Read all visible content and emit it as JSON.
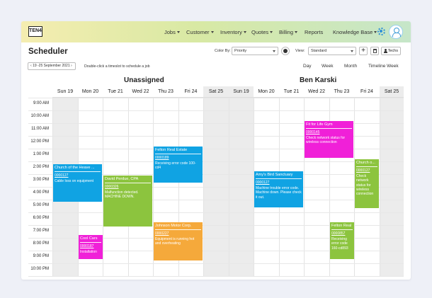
{
  "app": {
    "logo": "TEN4",
    "title": "Scheduler"
  },
  "nav": [
    {
      "label": "Jobs",
      "dropdown": true
    },
    {
      "label": "Customer",
      "dropdown": true
    },
    {
      "label": "Inventory",
      "dropdown": true
    },
    {
      "label": "Quotes",
      "dropdown": true
    },
    {
      "label": "Billing",
      "dropdown": true
    },
    {
      "label": "Reports",
      "dropdown": false
    },
    {
      "label": "Knowledge Base",
      "dropdown": true
    }
  ],
  "toolbar": {
    "color_by_label": "Color By:",
    "color_by_value": "Priority",
    "view_label": "View:",
    "view_value": "Standard",
    "add_label": "+",
    "techs_label": "Techs"
  },
  "date_range": "19 -25 September 2021",
  "hint": "Double-click a timeslot to schedule a job",
  "views": [
    "Day",
    "Week",
    "Month",
    "Timeline Week"
  ],
  "resources": [
    "Unassigned",
    "Ben Karski"
  ],
  "days": [
    "Sun 19",
    "Mon 20",
    "Tue 21",
    "Wed 22",
    "Thu 23",
    "Fri 24",
    "Sat 25",
    "Sun 19",
    "Mon 20",
    "Tue 21",
    "Wed 22",
    "Thu 23",
    "Fri 24",
    "Sat 25"
  ],
  "times": [
    "9:00 AM",
    "10:00 AM",
    "11:00 AM",
    "12:00 PM",
    "1:00 PM",
    "2:00 PM",
    "3:00 PM",
    "4:00 PM",
    "5:00 PM",
    "6:00 PM",
    "7:00 PM",
    "8:00 PM",
    "9:00 PM",
    "10:00 PM"
  ],
  "events": [
    {
      "title": "Church of the Heave ...",
      "code": "0000127",
      "desc": "Cable loss on equipment",
      "color": "#10a3e3"
    },
    {
      "title": "David Perdue, CPA",
      "code": "0000326",
      "desc": "Malfunction detected. MACHINE DOWN.",
      "color": "#8cc43e"
    },
    {
      "title": "Felton Real Estate",
      "code": "0000189",
      "desc": "Receiving error code 100-cd4",
      "color": "#10a3e3"
    },
    {
      "title": "Cool Cars",
      "code": "0000187",
      "desc": "Installation",
      "color": "#f020d8"
    },
    {
      "title": "Johnson Motor Corp.",
      "code": "0000227",
      "desc": "Equipment is running hot and overheating",
      "color": "#f5a93b"
    },
    {
      "title": "Fit for Life Gym",
      "code": "0000145",
      "desc": "Check network status for wireless connection",
      "color": "#f020d8"
    },
    {
      "title": "Amy's Bird Sanctuary",
      "code": "0000127",
      "desc": "Machine trouble error code. Machine down. Please check it out.",
      "color": "#10a3e3"
    },
    {
      "title": "Church o...",
      "code": "0000127",
      "desc": "Check network status for wireless connection",
      "color": "#8cc43e"
    },
    {
      "title": "Felton Real",
      "code": "0000857",
      "desc": "Receiving error code 160-cd893",
      "color": "#8cc43e"
    }
  ]
}
